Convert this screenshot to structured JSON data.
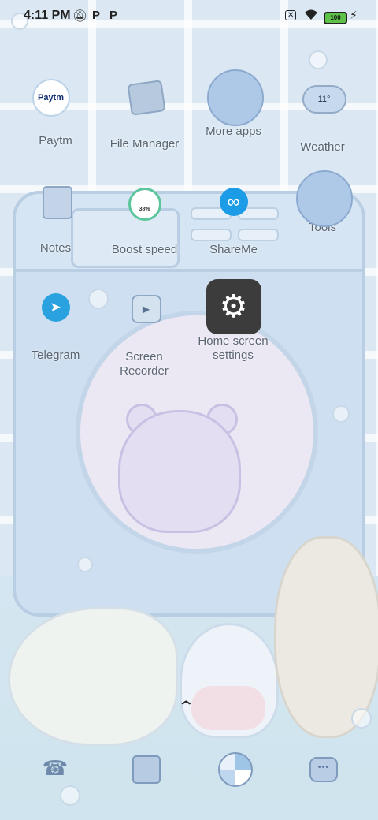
{
  "status_bar": {
    "time": "4:11 PM",
    "left_icons": [
      "notifications-off-icon",
      "p-app-icon",
      "p-app-icon"
    ],
    "right_icons": [
      "no-sim-icon",
      "wifi-icon",
      "battery-icon",
      "charging-icon"
    ],
    "battery_level": "100"
  },
  "apps": [
    {
      "label": "Paytm",
      "icon": "paytm-icon",
      "icon_text": "Paytm"
    },
    {
      "label": "File Manager",
      "icon": "file-manager-icon"
    },
    {
      "label": "More apps",
      "icon": "more-apps-folder-icon"
    },
    {
      "label": "Weather",
      "icon": "weather-icon",
      "icon_text": "11°"
    },
    {
      "label": "Notes",
      "icon": "notes-icon"
    },
    {
      "label": "Boost speed",
      "icon": "boost-speed-icon",
      "icon_text": "38%"
    },
    {
      "label": "ShareMe",
      "icon": "shareme-icon"
    },
    {
      "label": "Tools",
      "icon": "tools-folder-icon"
    },
    {
      "label": "Telegram",
      "icon": "telegram-icon"
    },
    {
      "label": "Screen Recorder",
      "icon": "screen-recorder-icon"
    },
    {
      "label": "Home screen settings",
      "icon": "settings-gear-icon"
    }
  ],
  "dock": [
    "phone-icon",
    "gallery-icon",
    "browser-icon",
    "messages-icon"
  ],
  "app_drawer_hint": "chevron-up-icon"
}
